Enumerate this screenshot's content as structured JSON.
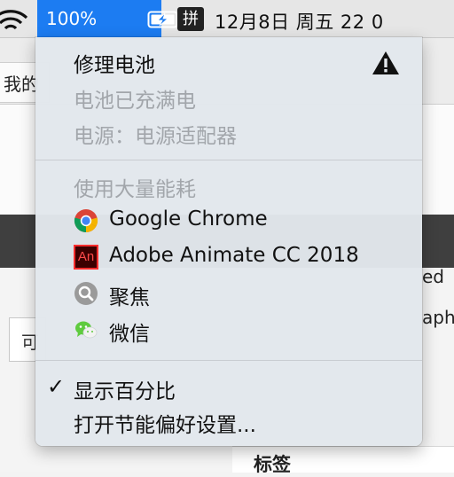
{
  "menubar": {
    "battery_percent": "100%",
    "input_method": "拼",
    "clock": "12月8日 周五  22 0"
  },
  "background": {
    "tab_text": "我的",
    "left_char": "可",
    "right_text_1": "ed",
    "right_text_2": "aph",
    "bottom_label": "标签"
  },
  "battery_menu": {
    "condition": "修理电池",
    "status": "电池已充满电",
    "power_source": "电源：电源适配器",
    "energy_header": "使用大量能耗",
    "apps": [
      {
        "name": "Google Chrome",
        "icon": "chrome-icon"
      },
      {
        "name": "Adobe Animate CC 2018",
        "icon": "animate-icon",
        "icon_text": "An"
      },
      {
        "name": "聚焦",
        "icon": "spotlight-icon"
      },
      {
        "name": "微信",
        "icon": "wechat-icon"
      }
    ],
    "show_percentage": "显示百分比",
    "show_percentage_checked": true,
    "checkmark": "✓",
    "open_preferences": "打开节能偏好设置..."
  },
  "colors": {
    "accent": "#1c7cf2",
    "menu_bg": "#e2e7ec",
    "disabled_text": "#a2a6ab"
  }
}
